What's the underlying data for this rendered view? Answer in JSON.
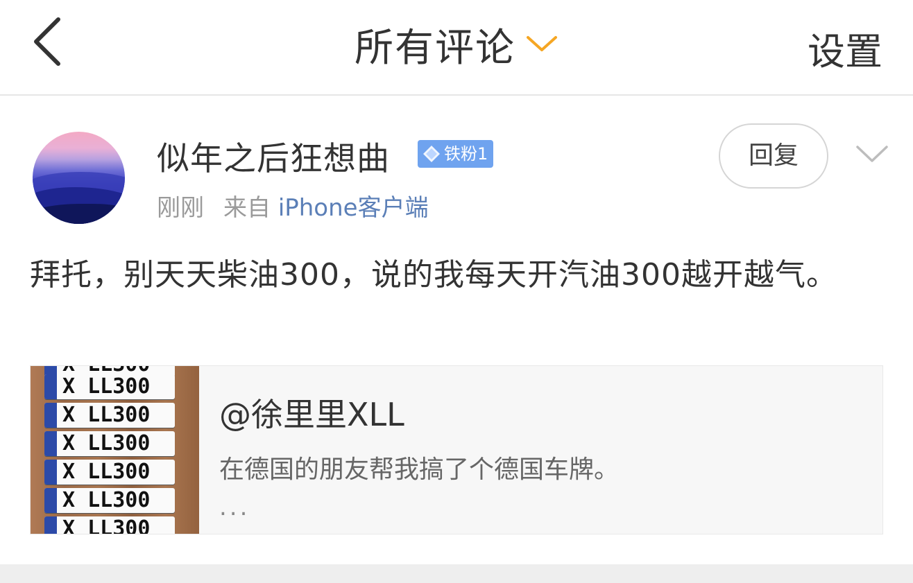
{
  "header": {
    "title": "所有评论",
    "settings_label": "设置",
    "accent_color": "#f5a623"
  },
  "comment": {
    "username": "似年之后狂想曲",
    "badge": "铁粉1",
    "time": "刚刚",
    "source_prefix": "来自",
    "source": "iPhone客户端",
    "reply_label": "回复",
    "text": "拜托，别天天柴油300，说的我每天开汽油300越开越气。"
  },
  "quoted": {
    "author": "@徐里里XLL",
    "excerpt": "在德国的朋友帮我搞了个德国车牌。",
    "ellipsis": "...",
    "plate_text": "X LL300"
  },
  "icons": {
    "back": "chevron-left-icon",
    "title_dropdown": "chevron-down-icon",
    "more": "chevron-down-icon",
    "badge": "diamond-icon"
  }
}
